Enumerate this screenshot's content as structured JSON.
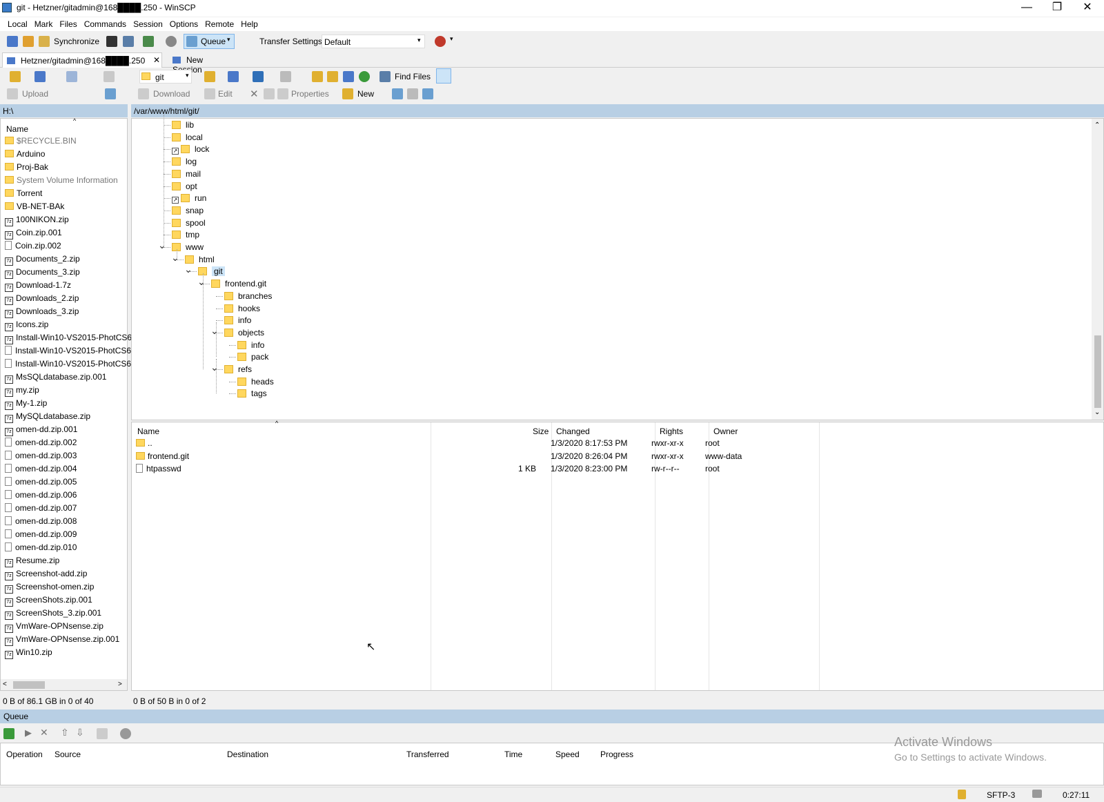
{
  "window": {
    "title": "git - Hetzner/gitadmin@168████.250 - WinSCP",
    "minimize": "—",
    "restore": "❐",
    "close": "✕"
  },
  "menu": [
    "Local",
    "Mark",
    "Files",
    "Commands",
    "Session",
    "Options",
    "Remote",
    "Help"
  ],
  "toolbar": {
    "synchronize": "Synchronize",
    "queue": "Queue",
    "transfer_settings_label": "Transfer Settings",
    "transfer_settings_value": "Default"
  },
  "tabs": {
    "active": "Hetzner/gitadmin@168████.250",
    "new_session": "New Session"
  },
  "local_toolbar": {
    "upload": "Upload"
  },
  "remote_toolbar": {
    "path_dropdown": "git",
    "find_files": "Find Files",
    "download": "Download",
    "edit": "Edit",
    "properties": "Properties",
    "new": "New"
  },
  "local": {
    "path": "H:\\",
    "column_name": "Name",
    "files": [
      {
        "name": "$RECYCLE.BIN",
        "type": "folder",
        "hidden": true
      },
      {
        "name": "Arduino",
        "type": "folder"
      },
      {
        "name": "Proj-Bak",
        "type": "folder"
      },
      {
        "name": "System Volume Information",
        "type": "folder",
        "hidden": true
      },
      {
        "name": "Torrent",
        "type": "folder"
      },
      {
        "name": "VB-NET-BAk",
        "type": "folder"
      },
      {
        "name": "100NIKON.zip",
        "type": "zip"
      },
      {
        "name": "Coin.zip.001",
        "type": "zip"
      },
      {
        "name": "Coin.zip.002",
        "type": "file"
      },
      {
        "name": "Documents_2.zip",
        "type": "zip"
      },
      {
        "name": "Documents_3.zip",
        "type": "zip"
      },
      {
        "name": "Download-1.7z",
        "type": "zip"
      },
      {
        "name": "Downloads_2.zip",
        "type": "zip"
      },
      {
        "name": "Downloads_3.zip",
        "type": "zip"
      },
      {
        "name": "Icons.zip",
        "type": "zip"
      },
      {
        "name": "Install-Win10-VS2015-PhotCS6",
        "type": "zip"
      },
      {
        "name": "Install-Win10-VS2015-PhotCS6",
        "type": "file"
      },
      {
        "name": "Install-Win10-VS2015-PhotCS6",
        "type": "file"
      },
      {
        "name": "MsSQLdatabase.zip.001",
        "type": "zip"
      },
      {
        "name": "my.zip",
        "type": "zip"
      },
      {
        "name": "My-1.zip",
        "type": "zip"
      },
      {
        "name": "MySQLdatabase.zip",
        "type": "zip"
      },
      {
        "name": "omen-dd.zip.001",
        "type": "zip"
      },
      {
        "name": "omen-dd.zip.002",
        "type": "file"
      },
      {
        "name": "omen-dd.zip.003",
        "type": "file"
      },
      {
        "name": "omen-dd.zip.004",
        "type": "file"
      },
      {
        "name": "omen-dd.zip.005",
        "type": "file"
      },
      {
        "name": "omen-dd.zip.006",
        "type": "file"
      },
      {
        "name": "omen-dd.zip.007",
        "type": "file"
      },
      {
        "name": "omen-dd.zip.008",
        "type": "file"
      },
      {
        "name": "omen-dd.zip.009",
        "type": "file"
      },
      {
        "name": "omen-dd.zip.010",
        "type": "file"
      },
      {
        "name": "Resume.zip",
        "type": "zip"
      },
      {
        "name": "Screenshot-add.zip",
        "type": "zip"
      },
      {
        "name": "Screenshot-omen.zip",
        "type": "zip"
      },
      {
        "name": "ScreenShots.zip.001",
        "type": "zip"
      },
      {
        "name": "ScreenShots_3.zip.001",
        "type": "zip"
      },
      {
        "name": "VmWare-OPNsense.zip",
        "type": "zip"
      },
      {
        "name": "VmWare-OPNsense.zip.001",
        "type": "zip"
      },
      {
        "name": "Win10.zip",
        "type": "zip"
      }
    ],
    "status": "0 B of 86.1 GB in 0 of 40"
  },
  "remote": {
    "path": "/var/www/html/git/",
    "tree": [
      {
        "name": "lib",
        "depth": 0,
        "link": false
      },
      {
        "name": "local",
        "depth": 0,
        "link": false
      },
      {
        "name": "lock",
        "depth": 0,
        "link": true
      },
      {
        "name": "log",
        "depth": 0,
        "link": false
      },
      {
        "name": "mail",
        "depth": 0,
        "link": false
      },
      {
        "name": "opt",
        "depth": 0,
        "link": false
      },
      {
        "name": "run",
        "depth": 0,
        "link": true
      },
      {
        "name": "snap",
        "depth": 0,
        "link": false
      },
      {
        "name": "spool",
        "depth": 0,
        "link": false
      },
      {
        "name": "tmp",
        "depth": 0,
        "link": false
      },
      {
        "name": "www",
        "depth": 0,
        "expanded": true
      },
      {
        "name": "html",
        "depth": 1,
        "expanded": true
      },
      {
        "name": "git",
        "depth": 2,
        "expanded": true,
        "selected": true
      },
      {
        "name": "frontend.git",
        "depth": 3,
        "expanded": true
      },
      {
        "name": "branches",
        "depth": 4
      },
      {
        "name": "hooks",
        "depth": 4
      },
      {
        "name": "info",
        "depth": 4
      },
      {
        "name": "objects",
        "depth": 4,
        "expanded": true
      },
      {
        "name": "info",
        "depth": 5
      },
      {
        "name": "pack",
        "depth": 5
      },
      {
        "name": "refs",
        "depth": 4,
        "expanded": true
      },
      {
        "name": "heads",
        "depth": 5
      },
      {
        "name": "tags",
        "depth": 5
      }
    ],
    "columns": {
      "name": "Name",
      "size": "Size",
      "changed": "Changed",
      "rights": "Rights",
      "owner": "Owner"
    },
    "files": [
      {
        "name": "..",
        "size": "",
        "changed": "1/3/2020 8:17:53 PM",
        "rights": "rwxr-xr-x",
        "owner": "root",
        "type": "up"
      },
      {
        "name": "frontend.git",
        "size": "",
        "changed": "1/3/2020 8:26:04 PM",
        "rights": "rwxr-xr-x",
        "owner": "www-data",
        "type": "folder"
      },
      {
        "name": "htpasswd",
        "size": "1 KB",
        "changed": "1/3/2020 8:23:00 PM",
        "rights": "rw-r--r--",
        "owner": "root",
        "type": "file"
      }
    ],
    "status": "0 B of 50 B in 0 of 2"
  },
  "queue": {
    "title": "Queue",
    "columns": [
      "Operation",
      "Source",
      "Destination",
      "Transferred",
      "Time",
      "Speed",
      "Progress"
    ]
  },
  "watermark": {
    "line1": "Activate Windows",
    "line2": "Go to Settings to activate Windows."
  },
  "statusbar": {
    "protocol": "SFTP-3",
    "time": "0:27:11"
  }
}
